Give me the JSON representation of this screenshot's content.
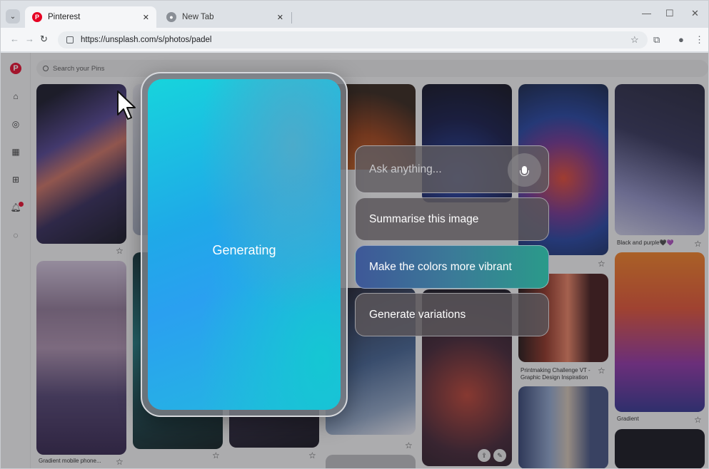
{
  "browser": {
    "tabs": [
      {
        "title": "Pinterest",
        "favicon": "pinterest-icon",
        "active": true
      },
      {
        "title": "New Tab",
        "favicon": "chrome-icon",
        "active": false
      }
    ],
    "url": "https://unsplash.com/s/photos/padel",
    "window_controls": [
      "minimize-icon",
      "maximize-icon",
      "close-icon"
    ]
  },
  "pinterest": {
    "search_placeholder": "Search your Pins",
    "sidebar_icons": [
      "pinterest-logo-icon",
      "home-icon",
      "explore-icon",
      "boards-icon",
      "create-icon",
      "notifications-icon",
      "messages-icon"
    ],
    "pins": [
      {
        "caption": "Gradient mobile phone..."
      },
      {
        "caption": "Black and purple🖤💜"
      },
      {
        "caption": "Printmaking Challenge VT - Graphic Design Inspiration"
      },
      {
        "caption": "Gradient"
      }
    ]
  },
  "overlay": {
    "generating_label": "Generating",
    "ask_placeholder": "Ask anything...",
    "suggestions": [
      "Summarise this image",
      "Make the colors more vibrant",
      "Generate variations"
    ]
  },
  "colors": {
    "pinterest_red": "#e60023",
    "active_suggestion_start": "#3e5898",
    "active_suggestion_end": "#2a9a8a"
  }
}
